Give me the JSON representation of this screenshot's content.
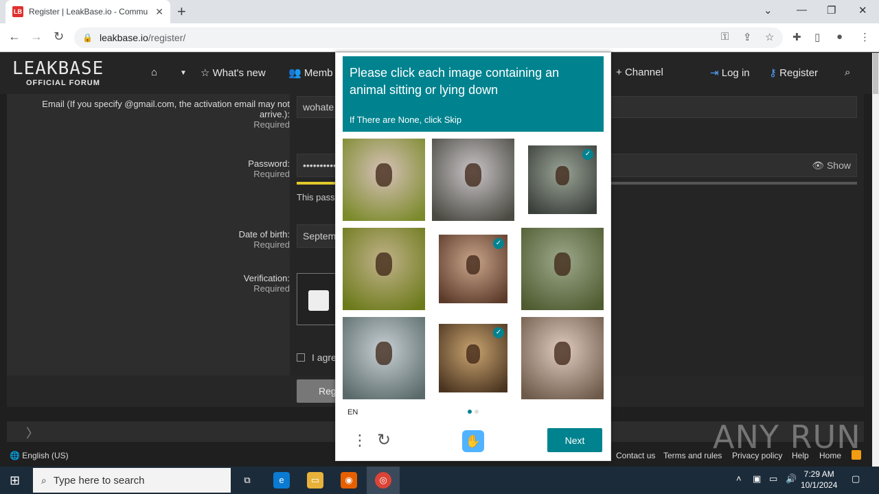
{
  "browser": {
    "tab_title": "Register | LeakBase.io - Commu",
    "tab_favicon": "LB",
    "url_host": "leakbase.io",
    "url_path": "/register/"
  },
  "site": {
    "logo_main": "LEAKBASE",
    "logo_sub": "OFFICIAL FORUM",
    "nav": {
      "whats_new": "What's new",
      "members": "Memb",
      "channel": "Channel",
      "login": "Log in",
      "register": "Register"
    }
  },
  "form": {
    "email_label": "Email (If you specify @gmail.com, the activation email may not arrive.):",
    "email_required": "Required",
    "email_value": "wohate",
    "password_label": "Password:",
    "password_required": "Required",
    "password_value": "••••••••••",
    "show_label": "Show",
    "password_note": "This pass",
    "dob_label": "Date of birth:",
    "dob_required": "Required",
    "dob_value": "Septem",
    "verification_label": "Verification:",
    "verification_required": "Required",
    "agree_text": "I agre",
    "register_button": "Reg"
  },
  "footer": {
    "language": "English (US)",
    "links": [
      "Contact us",
      "Terms and rules",
      "Privacy policy",
      "Help",
      "Home"
    ]
  },
  "captcha": {
    "title": "Please click each image containing an animal sitting or lying down",
    "subtitle": "If There are None, click Skip",
    "language": "EN",
    "next_label": "Next",
    "tiles": [
      {
        "selected": false,
        "colors": [
          "#d6c1b8",
          "#7b8a2a"
        ]
      },
      {
        "selected": false,
        "colors": [
          "#c9c4c7",
          "#4a4a42"
        ]
      },
      {
        "selected": true,
        "colors": [
          "#9aa497",
          "#3a3f3a"
        ]
      },
      {
        "selected": false,
        "colors": [
          "#c1b28a",
          "#6c7a1a"
        ]
      },
      {
        "selected": true,
        "colors": [
          "#caa58b",
          "#5b3a2a"
        ]
      },
      {
        "selected": false,
        "colors": [
          "#9ca88a",
          "#4f5b30"
        ]
      },
      {
        "selected": false,
        "colors": [
          "#c8d0d4",
          "#5a6a6a"
        ]
      },
      {
        "selected": true,
        "colors": [
          "#c9a470",
          "#4a3420"
        ]
      },
      {
        "selected": false,
        "colors": [
          "#e0ccc0",
          "#6e5a4a"
        ]
      }
    ]
  },
  "watermark": "ANY RUN",
  "taskbar": {
    "search_placeholder": "Type here to search",
    "time": "7:29 AM",
    "date": "10/1/2024"
  }
}
